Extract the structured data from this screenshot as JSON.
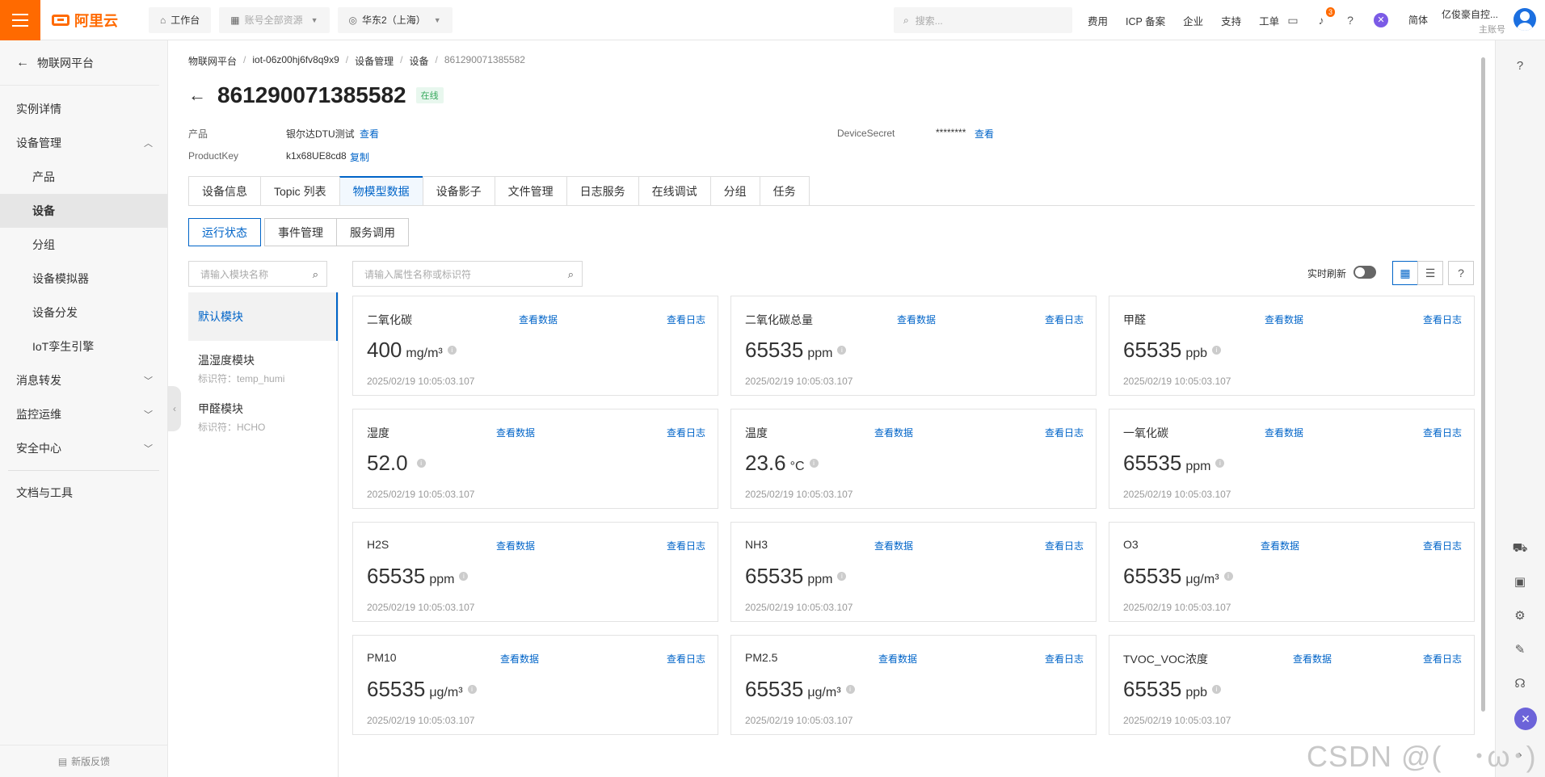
{
  "topbar": {
    "logo": "阿里云",
    "workbench": "工作台",
    "resources": "账号全部资源",
    "region": "华东2（上海）",
    "search_placeholder": "搜索...",
    "links": [
      "费用",
      "ICP 备案",
      "企业",
      "支持",
      "工单"
    ],
    "notification_count": "3",
    "lang": "简体",
    "user_name": "亿俊豪自控...",
    "user_role": "主账号",
    "accent": "#ff6a00"
  },
  "sidebar": {
    "back_label": "物联网平台",
    "items": [
      {
        "label": "实例详情"
      },
      {
        "label": "设备管理"
      },
      {
        "label": "产品"
      },
      {
        "label": "设备"
      },
      {
        "label": "分组"
      },
      {
        "label": "设备模拟器"
      },
      {
        "label": "设备分发"
      },
      {
        "label": "IoT孪生引擎"
      },
      {
        "label": "消息转发"
      },
      {
        "label": "监控运维"
      },
      {
        "label": "安全中心"
      },
      {
        "label": "文档与工具"
      }
    ],
    "feedback": "新版反馈"
  },
  "breadcrumb": [
    "物联网平台",
    "iot-06z00hj6fv8q9x9",
    "设备管理",
    "设备",
    "861290071385582"
  ],
  "device": {
    "name": "861290071385582",
    "status": "在线",
    "product_label": "产品",
    "product_value": "银尔达DTU测试",
    "view": "查看",
    "productkey_label": "ProductKey",
    "productkey_value": "k1x68UE8cd8",
    "copy": "复制",
    "secret_label": "DeviceSecret",
    "secret_value": "********"
  },
  "tabs": [
    "设备信息",
    "Topic 列表",
    "物模型数据",
    "设备影子",
    "文件管理",
    "日志服务",
    "在线调试",
    "分组",
    "任务"
  ],
  "subtabs": [
    "运行状态",
    "事件管理",
    "服务调用"
  ],
  "module_search_placeholder": "请输入模块名称",
  "prop_search_placeholder": "请输入属性名称或标识符",
  "modules": [
    {
      "name": "默认模块",
      "id": ""
    },
    {
      "name": "温湿度模块",
      "id": "标识符：temp_humi"
    },
    {
      "name": "甲醛模块",
      "id": "标识符：HCHO"
    }
  ],
  "realtime_label": "实时刷新",
  "card_links": {
    "data": "查看数据",
    "log": "查看日志"
  },
  "cards": [
    {
      "name": "二氧化碳",
      "value": "400",
      "unit": "mg/m³",
      "ts": "2025/02/19 10:05:03.107"
    },
    {
      "name": "二氧化碳总量",
      "value": "65535",
      "unit": "ppm",
      "ts": "2025/02/19 10:05:03.107"
    },
    {
      "name": "甲醛",
      "value": "65535",
      "unit": "ppb",
      "ts": "2025/02/19 10:05:03.107"
    },
    {
      "name": "湿度",
      "value": "52.0",
      "unit": "",
      "ts": "2025/02/19 10:05:03.107"
    },
    {
      "name": "温度",
      "value": "23.6",
      "unit": "°C",
      "ts": "2025/02/19 10:05:03.107"
    },
    {
      "name": "一氧化碳",
      "value": "65535",
      "unit": "ppm",
      "ts": "2025/02/19 10:05:03.107"
    },
    {
      "name": "H2S",
      "value": "65535",
      "unit": "ppm",
      "ts": "2025/02/19 10:05:03.107"
    },
    {
      "name": "NH3",
      "value": "65535",
      "unit": "ppm",
      "ts": "2025/02/19 10:05:03.107"
    },
    {
      "name": "O3",
      "value": "65535",
      "unit": "μg/m³",
      "ts": "2025/02/19 10:05:03.107"
    },
    {
      "name": "PM10",
      "value": "65535",
      "unit": "μg/m³",
      "ts": "2025/02/19 10:05:03.107"
    },
    {
      "name": "PM2.5",
      "value": "65535",
      "unit": "μg/m³",
      "ts": "2025/02/19 10:05:03.107"
    },
    {
      "name": "TVOC_VOC浓度",
      "value": "65535",
      "unit": "ppb",
      "ts": "2025/02/19 10:05:03.107"
    }
  ],
  "watermark": "CSDN @(　･ω･)"
}
